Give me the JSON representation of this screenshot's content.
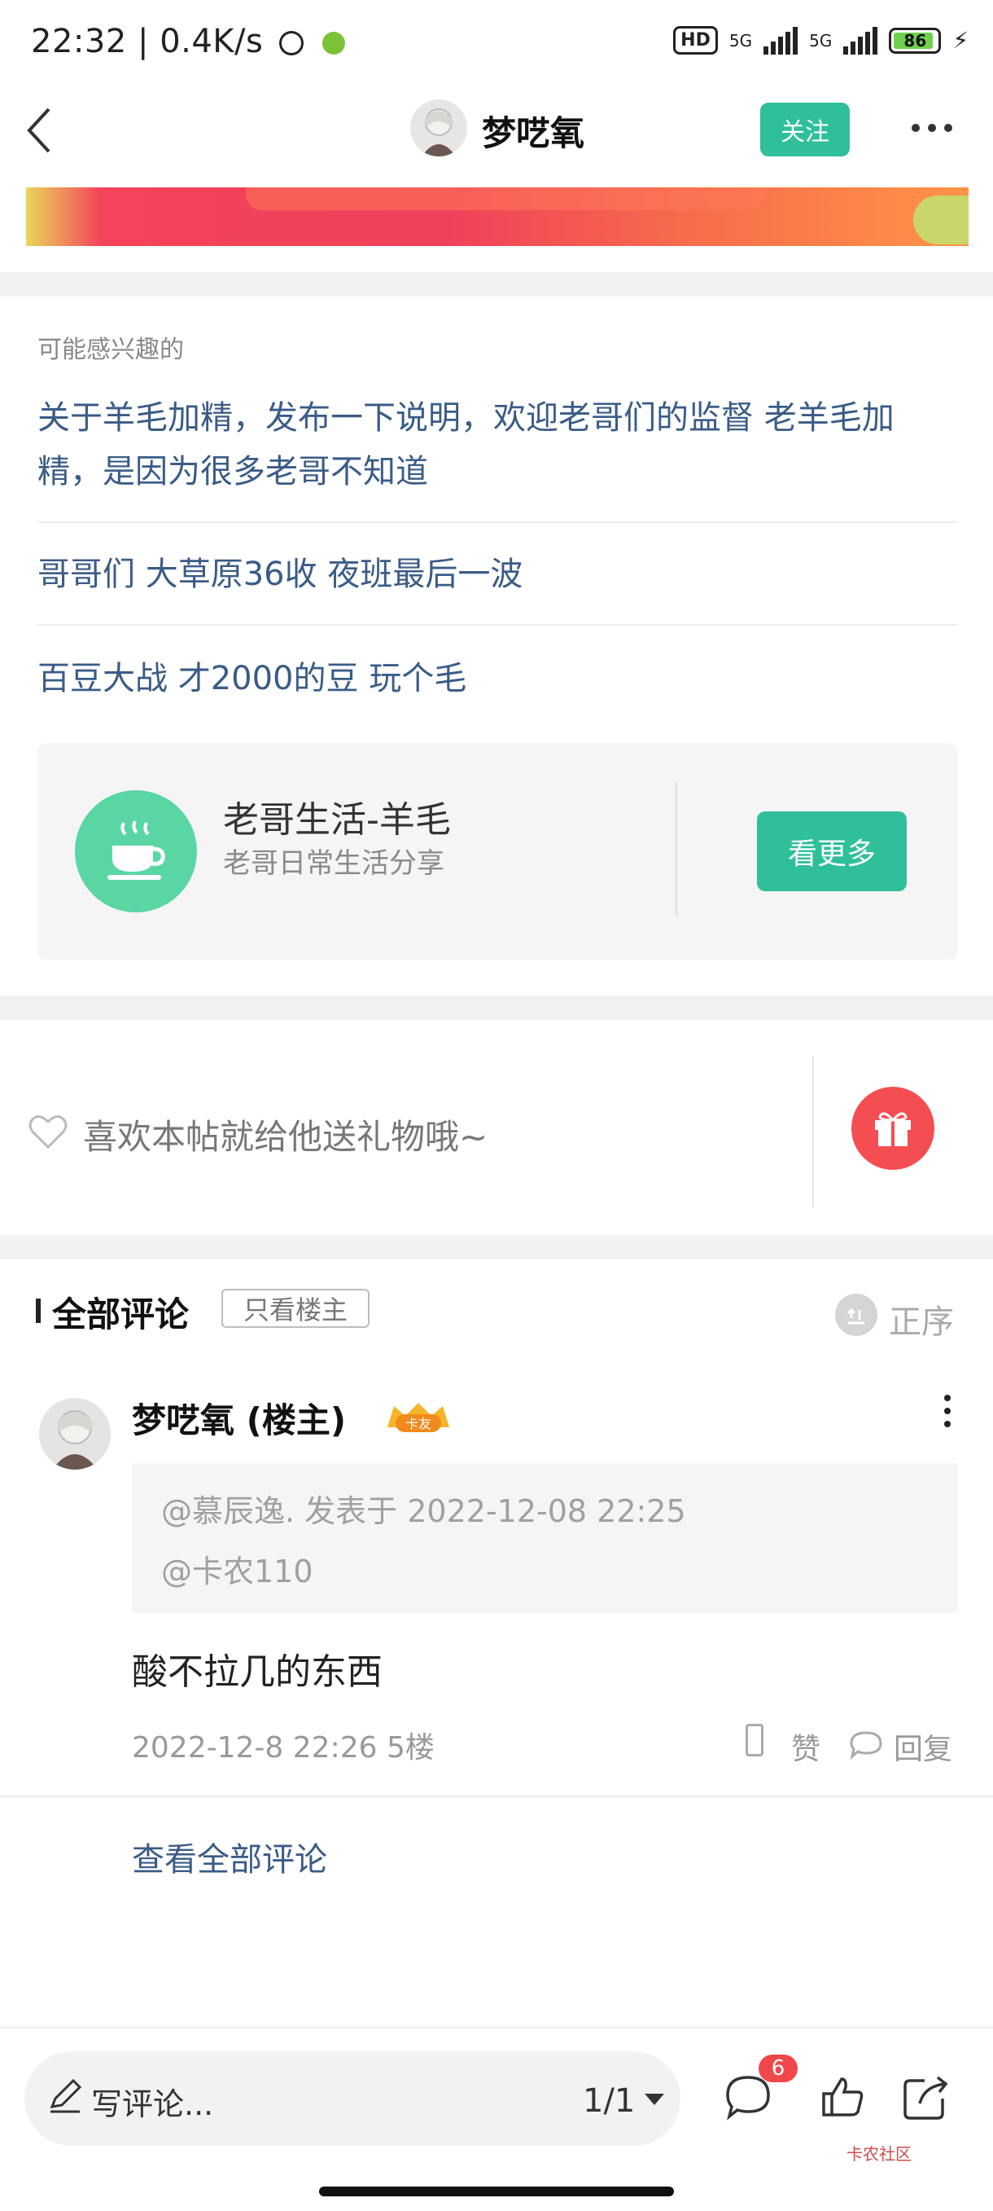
{
  "status_bar": {
    "time": "22:32",
    "net_speed": "0.4K/s",
    "hd": "HD",
    "sim1": "5G",
    "sim2": "5G",
    "battery": "86"
  },
  "nav": {
    "title": "梦呓氧",
    "follow_label": "关注"
  },
  "interest": {
    "label": "可能感兴趣的",
    "items": [
      "关于羊毛加精，发布一下说明，欢迎老哥们的监督 老羊毛加精，是因为很多老哥不知道",
      "哥哥们 大草原36收 夜班最后一波",
      "百豆大战 才2000的豆 玩个毛"
    ],
    "board": {
      "title": "老哥生活-羊毛",
      "subtitle": "老哥日常生活分享",
      "button": "看更多"
    }
  },
  "gift": {
    "prompt": "喜欢本帖就给他送礼物哦~"
  },
  "comments": {
    "title": "全部评论",
    "only_op": "只看楼主",
    "order": "正序",
    "item": {
      "author": "梦呓氧 (楼主)",
      "badge": "卡友",
      "quote_header": "@慕辰逸. 发表于 2022-12-08 22:25",
      "quote_body": "@卡农110",
      "body": "酸不拉几的东西",
      "meta": "2022-12-8 22:26  5楼",
      "like": "赞",
      "reply": "回复"
    },
    "view_all": "查看全部评论"
  },
  "bottom": {
    "write_placeholder": "写评论...",
    "page": "1/1",
    "comment_count": "6",
    "watermark": "卡农社区"
  }
}
